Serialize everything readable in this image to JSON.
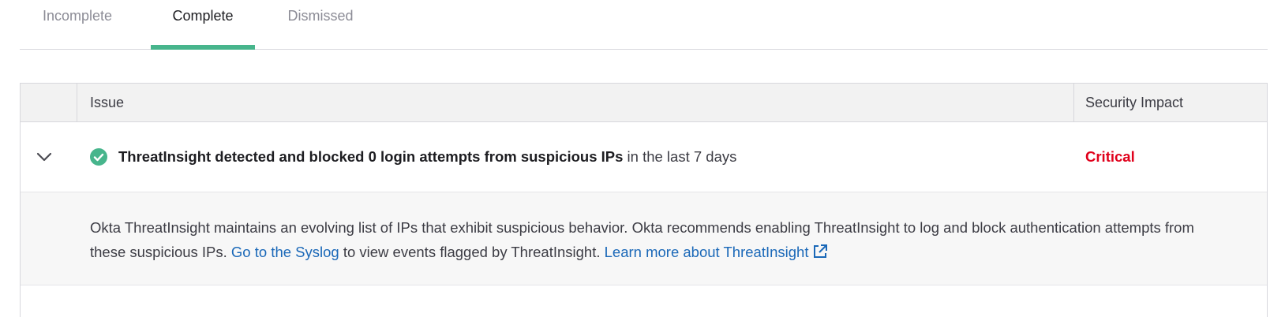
{
  "tabs": [
    {
      "label": "Incomplete",
      "active": false
    },
    {
      "label": "Complete",
      "active": true
    },
    {
      "label": "Dismissed",
      "active": false
    }
  ],
  "table": {
    "columns": {
      "issue": "Issue",
      "impact": "Security Impact"
    },
    "rows": [
      {
        "status_icon": "check-circle-icon",
        "title_bold": "ThreatInsight detected and blocked 0 login attempts from suspicious IPs",
        "title_rest": " in the last 7 days",
        "impact": "Critical",
        "expanded": true,
        "detail": {
          "text_1": "Okta ThreatInsight maintains an evolving list of IPs that exhibit suspicious behavior. Okta recommends enabling ThreatInsight to log and block authentication attempts from these suspicious IPs. ",
          "link_syslog": "Go to the Syslog",
          "text_2": " to view events flagged by ThreatInsight. ",
          "link_learn": "Learn more about ThreatInsight",
          "link_icon": "external-link-icon"
        }
      }
    ]
  },
  "colors": {
    "tab_accent": "#47b58c",
    "critical": "#e0001b",
    "link": "#1a68b8",
    "success": "#47b58c"
  }
}
